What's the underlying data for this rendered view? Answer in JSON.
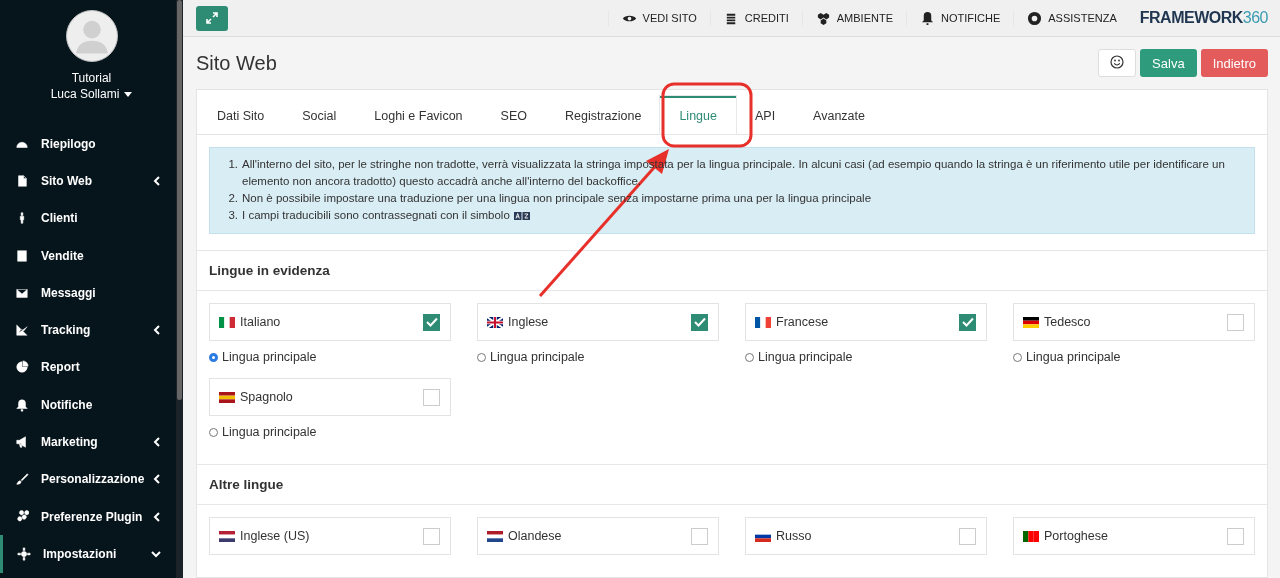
{
  "sidebar": {
    "user": {
      "line1": "Tutorial",
      "line2": "Luca Sollami"
    },
    "items": [
      {
        "label": "Riepilogo",
        "active": false
      },
      {
        "label": "Sito Web",
        "expanded": false,
        "active": false
      },
      {
        "label": "Clienti",
        "active": false
      },
      {
        "label": "Vendite",
        "active": false
      },
      {
        "label": "Messaggi",
        "active": false
      },
      {
        "label": "Tracking",
        "expanded": false,
        "active": false
      },
      {
        "label": "Report",
        "active": false
      },
      {
        "label": "Notifiche",
        "active": false
      },
      {
        "label": "Marketing",
        "expanded": false,
        "active": false
      },
      {
        "label": "Personalizzazione",
        "expanded": false,
        "active": false
      },
      {
        "label": "Preferenze Plugin",
        "expanded": false,
        "active": false
      },
      {
        "label": "Impostazioni",
        "expanded": true,
        "active": true
      }
    ]
  },
  "topbar": {
    "nav": [
      "VEDI SITO",
      "CREDITI",
      "AMBIENTE",
      "NOTIFICHE",
      "ASSISTENZA"
    ],
    "logo": {
      "text": "FRAMEWORK",
      "accent": "360"
    }
  },
  "page": {
    "title": "Sito Web",
    "buttons": [
      {
        "kind": "icon"
      },
      {
        "kind": "save",
        "label": "Salva"
      },
      {
        "kind": "back",
        "label": "Indietro"
      }
    ]
  },
  "tabs": [
    {
      "label": "Dati Sito",
      "selected": false
    },
    {
      "label": "Social",
      "selected": false
    },
    {
      "label": "Loghi e Favicon",
      "selected": false
    },
    {
      "label": "SEO",
      "selected": false
    },
    {
      "label": "Registrazione",
      "selected": false
    },
    {
      "label": "Lingue",
      "selected": true
    },
    {
      "label": "API",
      "selected": false
    },
    {
      "label": "Avanzate",
      "selected": false
    }
  ],
  "info": [
    {
      "marker": "1.",
      "text": "All'interno del sito, per le stringhe non tradotte, verrà visualizzata la stringa impostata per la lingua principale. In alcuni casi (ad esempio quando la stringa è un riferimento utile per identificare un elemento non ancora tradotto) questo accadrà anche all'interno del backoffice.",
      "symbol": false
    },
    {
      "marker": "2.",
      "text": "Non è possibile impostare una traduzione per una lingua non principale senza impostarne prima una per la lingua principale",
      "symbol": false
    },
    {
      "marker": "3.",
      "text": "I campi traducibili sono contrassegnati con il simbolo",
      "symbol": true
    }
  ],
  "sections": [
    {
      "title": "Lingue in evidenza",
      "languages": [
        {
          "name": "Italiano",
          "checked": true,
          "primary": true,
          "primary_label": "Lingua principale"
        },
        {
          "name": "Inglese",
          "checked": true,
          "primary": false,
          "primary_label": "Lingua principale"
        },
        {
          "name": "Francese",
          "checked": true,
          "primary": false,
          "primary_label": "Lingua principale"
        },
        {
          "name": "Tedesco",
          "checked": false,
          "primary": false,
          "primary_label": "Lingua principale"
        },
        {
          "name": "Spagnolo",
          "checked": false,
          "primary": false,
          "primary_label": "Lingua principale"
        }
      ]
    },
    {
      "title": "Altre lingue",
      "languages": [
        {
          "name": "Inglese (US)",
          "checked": false
        },
        {
          "name": "Olandese",
          "checked": false
        },
        {
          "name": "Russo",
          "checked": false
        },
        {
          "name": "Portoghese",
          "checked": false
        }
      ]
    }
  ],
  "callout": {
    "frame": {
      "color": "#e8302a"
    },
    "arrow": {
      "color": "#e8302a"
    }
  }
}
